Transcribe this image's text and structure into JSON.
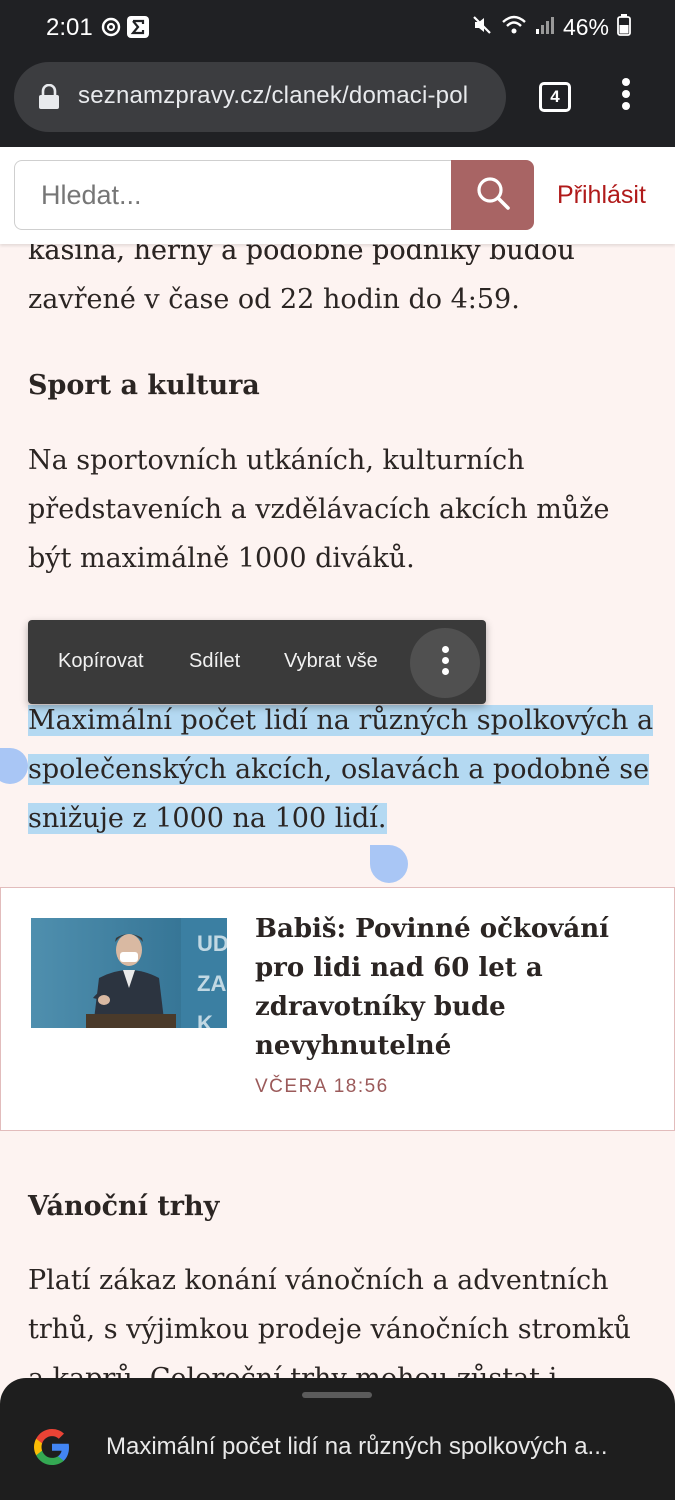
{
  "status_bar": {
    "time": "2:01",
    "battery": "46%",
    "icons": [
      "at-sign-icon",
      "sigma-app-icon",
      "mute-icon",
      "wifi-icon",
      "signal-icon",
      "battery-icon"
    ]
  },
  "browser": {
    "url": "seznamzpravy.cz/clanek/domaci-pol",
    "tab_count": "4"
  },
  "header": {
    "search_placeholder": "Hledat...",
    "login_label": "Přihlásit"
  },
  "article": {
    "clipped_top_line": "kasina, herny a podobné podniky budou",
    "para1_line": "zavřené v čase od 22 hodin do 4:59.",
    "heading_sport": "Sport a kultura",
    "para_sport": "Na sportovních utkáních, kulturních představeních a vzdělávacích akcích může být maximálně 1000 diváků.",
    "selected_line1": "Maximální počet lidí na různých spolkových a",
    "selected_line2": "společenských akcích, oslavách a podobně se",
    "selected_line3": "snižuje z 1000 na 100 lidí.",
    "heading_xmas": "Vánoční trhy",
    "para_xmas": "Platí zákaz konání vánočních a adventních trhů, s výjimkou prodeje vánočních stromků a kaprů. Celoroční trhy mohou zůstat i nadále"
  },
  "context_menu": {
    "copy": "Kopírovat",
    "share": "Sdílet",
    "select_all": "Vybrat vše"
  },
  "related": {
    "title": "Babiš: Povinné očkování pro lidi nad 60 let a zdravotníky bude nevyhnutelné",
    "time": "VČERA 18:56",
    "thumb_overlay_text": "UD ZA K"
  },
  "bottom_sheet": {
    "text": "Maximální počet lidí na různých spolkových a..."
  },
  "colors": {
    "page_bg": "#fdf3f1",
    "search_button": "#a86464",
    "login": "#b01a1a",
    "selection": "#b4d9f2"
  }
}
